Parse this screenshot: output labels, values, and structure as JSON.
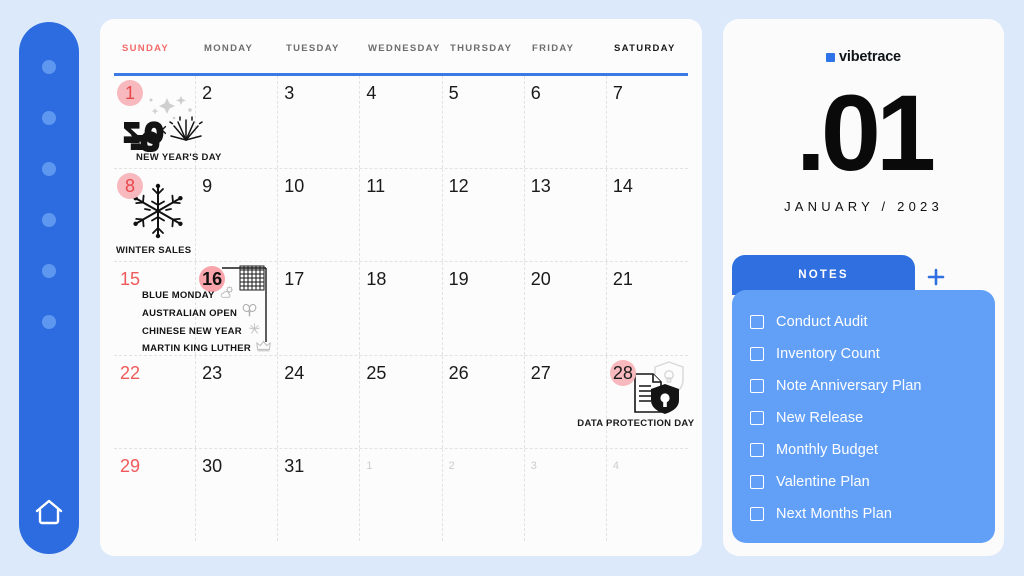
{
  "sidebar": {
    "dot_count": 6,
    "home_icon": "home-icon",
    "accent": "#2d6ce0",
    "dot_color": "#5e97f0"
  },
  "calendar": {
    "weekday_headers": [
      "SUNDAY",
      "MONDAY",
      "TUESDAY",
      "WEDNESDAY",
      "THURSDAY",
      "FRIDAY",
      "SATURDAY"
    ],
    "rule_color": "#3b7ae4",
    "weeks": [
      [
        {
          "num": "1",
          "type": "sunday-circled",
          "art": "fireworks-2023",
          "label": "NEW YEAR'S DAY"
        },
        {
          "num": "2",
          "type": "normal"
        },
        {
          "num": "3",
          "type": "normal"
        },
        {
          "num": "4",
          "type": "normal"
        },
        {
          "num": "5",
          "type": "normal"
        },
        {
          "num": "6",
          "type": "normal"
        },
        {
          "num": "7",
          "type": "normal"
        }
      ],
      [
        {
          "num": "8",
          "type": "sunday-circled",
          "art": "snowflake",
          "label": "WINTER SALES"
        },
        {
          "num": "9",
          "type": "normal"
        },
        {
          "num": "10",
          "type": "normal"
        },
        {
          "num": "11",
          "type": "normal"
        },
        {
          "num": "12",
          "type": "normal"
        },
        {
          "num": "13",
          "type": "normal"
        },
        {
          "num": "14",
          "type": "normal"
        }
      ],
      [
        {
          "num": "15",
          "type": "sunday"
        },
        {
          "num": "16",
          "type": "circled-strong",
          "art": "grid-lines",
          "events": [
            {
              "text": "BLUE MONDAY",
              "icon": "cloud-sun-icon"
            },
            {
              "text": "AUSTRALIAN OPEN",
              "icon": "tennis-racket-icon"
            },
            {
              "text": "CHINESE NEW YEAR",
              "icon": "firecracker-icon"
            },
            {
              "text": "MARTIN KING LUTHER",
              "icon": "crown-icon"
            }
          ]
        },
        {
          "num": "17",
          "type": "normal"
        },
        {
          "num": "18",
          "type": "normal"
        },
        {
          "num": "19",
          "type": "normal"
        },
        {
          "num": "20",
          "type": "normal"
        },
        {
          "num": "21",
          "type": "normal"
        }
      ],
      [
        {
          "num": "22",
          "type": "sunday"
        },
        {
          "num": "23",
          "type": "normal"
        },
        {
          "num": "24",
          "type": "normal"
        },
        {
          "num": "25",
          "type": "normal"
        },
        {
          "num": "26",
          "type": "normal"
        },
        {
          "num": "27",
          "type": "normal"
        },
        {
          "num": "28",
          "type": "circled",
          "art": "document-shield-lock",
          "label": "DATA PROTECTION DAY"
        }
      ],
      [
        {
          "num": "29",
          "type": "sunday"
        },
        {
          "num": "30",
          "type": "normal"
        },
        {
          "num": "31",
          "type": "normal"
        },
        {
          "num": "1",
          "type": "muted"
        },
        {
          "num": "2",
          "type": "muted"
        },
        {
          "num": "3",
          "type": "muted"
        },
        {
          "num": "4",
          "type": "muted"
        }
      ]
    ]
  },
  "right_panel": {
    "brand": "vibetrace",
    "brand_mark_color": "#2e74e8",
    "big_date": ".01",
    "month_line": "JANUARY / 2023",
    "notes_tab_label": "NOTES",
    "add_note_icon": "plus-icon",
    "notes": [
      "Conduct Audit",
      "Inventory Count",
      "Note Anniversary Plan",
      "New Release",
      "Monthly Budget",
      "Valentine Plan",
      "Next Months Plan"
    ],
    "notes_panel_color": "#62a0f8",
    "notes_tab_color": "#2f6fe0"
  }
}
